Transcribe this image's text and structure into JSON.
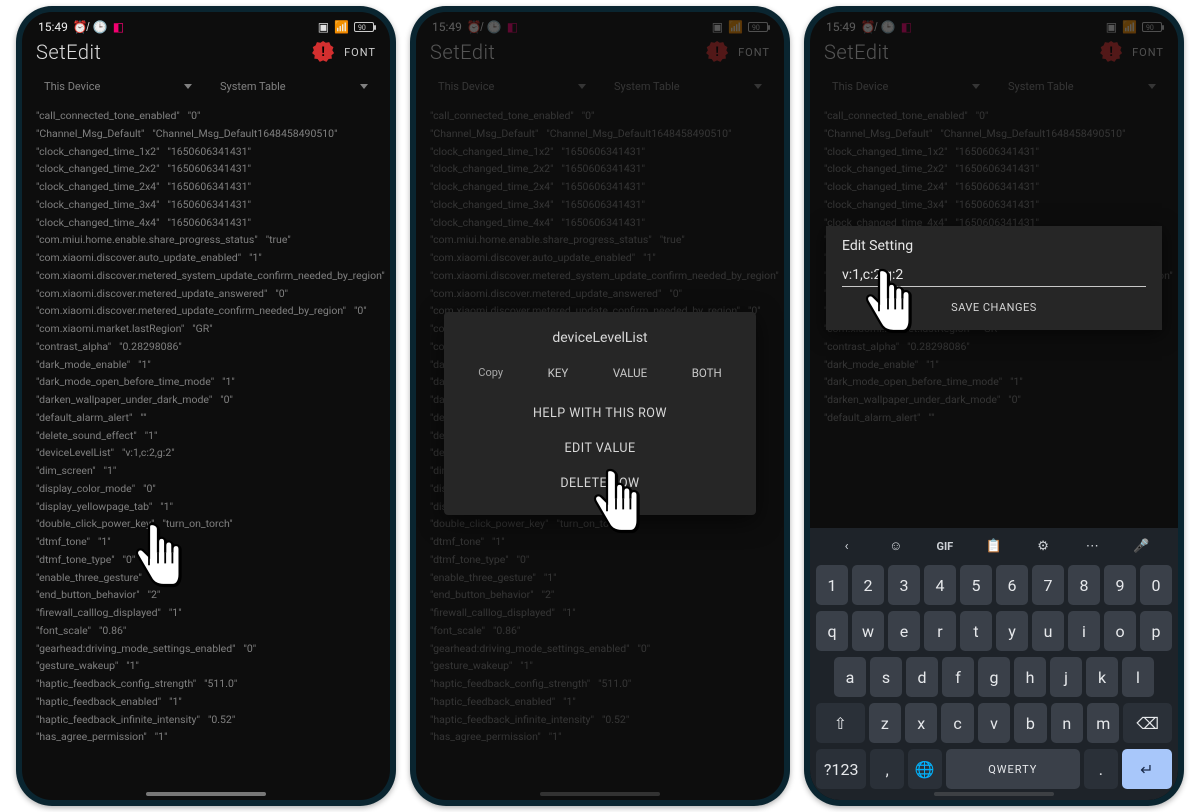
{
  "status": {
    "time": "15:49",
    "icons_left": [
      "alarm-off",
      "clock",
      "app-icon"
    ],
    "icons_right": [
      "vibrate",
      "wifi"
    ],
    "battery": "90"
  },
  "appbar": {
    "title": "SetEdit",
    "font_label": "FONT"
  },
  "dropdowns": {
    "device": "This Device",
    "table": "System Table"
  },
  "settings": [
    {
      "k": "call_connected_tone_enabled",
      "v": "0"
    },
    {
      "k": "Channel_Msg_Default",
      "v": "Channel_Msg_Default1648458490510"
    },
    {
      "k": "clock_changed_time_1x2",
      "v": "1650606341431"
    },
    {
      "k": "clock_changed_time_2x2",
      "v": "1650606341431"
    },
    {
      "k": "clock_changed_time_2x4",
      "v": "1650606341431"
    },
    {
      "k": "clock_changed_time_3x4",
      "v": "1650606341431"
    },
    {
      "k": "clock_changed_time_4x4",
      "v": "1650606341431"
    },
    {
      "k": "com.miui.home.enable.share_progress_status",
      "v": "true"
    },
    {
      "k": "com.xiaomi.discover.auto_update_enabled",
      "v": "1"
    },
    {
      "k": "com.xiaomi.discover.metered_system_update_confirm_needed_by_region",
      "v": "0"
    },
    {
      "k": "com.xiaomi.discover.metered_update_answered",
      "v": "0"
    },
    {
      "k": "com.xiaomi.discover.metered_update_confirm_needed_by_region",
      "v": "0"
    },
    {
      "k": "com.xiaomi.market.lastRegion",
      "v": "GR"
    },
    {
      "k": "contrast_alpha",
      "v": "0.28298086"
    },
    {
      "k": "dark_mode_enable",
      "v": "1"
    },
    {
      "k": "dark_mode_open_before_time_mode",
      "v": "1"
    },
    {
      "k": "darken_wallpaper_under_dark_mode",
      "v": "0"
    },
    {
      "k": "default_alarm_alert",
      "v": ""
    },
    {
      "k": "delete_sound_effect",
      "v": "1"
    },
    {
      "k": "deviceLevelList",
      "v": "v:1,c:2,g:2"
    },
    {
      "k": "dim_screen",
      "v": "1"
    },
    {
      "k": "display_color_mode",
      "v": "0"
    },
    {
      "k": "display_yellowpage_tab",
      "v": "1"
    },
    {
      "k": "double_click_power_key",
      "v": "turn_on_torch"
    },
    {
      "k": "dtmf_tone",
      "v": "1"
    },
    {
      "k": "dtmf_tone_type",
      "v": "0"
    },
    {
      "k": "enable_three_gesture",
      "v": "1"
    },
    {
      "k": "end_button_behavior",
      "v": "2"
    },
    {
      "k": "firewall_calllog_displayed",
      "v": "1"
    },
    {
      "k": "font_scale",
      "v": "0.86"
    },
    {
      "k": "gearhead:driving_mode_settings_enabled",
      "v": "0"
    },
    {
      "k": "gesture_wakeup",
      "v": "1"
    },
    {
      "k": "haptic_feedback_config_strength",
      "v": "511.0"
    },
    {
      "k": "haptic_feedback_enabled",
      "v": "1"
    },
    {
      "k": "haptic_feedback_infinite_intensity",
      "v": "0.52"
    },
    {
      "k": "has_agree_permission",
      "v": "1"
    }
  ],
  "context_menu": {
    "title": "deviceLevelList",
    "copy_label": "Copy",
    "key_label": "KEY",
    "value_label": "VALUE",
    "both_label": "BOTH",
    "help_label": "HELP WITH THIS ROW",
    "edit_label": "EDIT VALUE",
    "delete_label": "DELETE ROW"
  },
  "edit_dialog": {
    "title": "Edit Setting",
    "value": "v:1,c:2,g:2",
    "save_label": "SAVE CHANGES"
  },
  "keyboard": {
    "tools": [
      "‹",
      "☺",
      "GIF",
      "📋",
      "⚙",
      "⋯",
      "🎤"
    ],
    "row1": [
      "1",
      "2",
      "3",
      "4",
      "5",
      "6",
      "7",
      "8",
      "9",
      "0"
    ],
    "row2": [
      "q",
      "w",
      "e",
      "r",
      "t",
      "y",
      "u",
      "i",
      "o",
      "p"
    ],
    "row3": [
      "a",
      "s",
      "d",
      "f",
      "g",
      "h",
      "j",
      "k",
      "l"
    ],
    "row4_shift": "⇧",
    "row4": [
      "z",
      "x",
      "c",
      "v",
      "b",
      "n",
      "m"
    ],
    "row4_bksp": "⌫",
    "row5_sym": "?123",
    "row5_comma": ",",
    "row5_emoji": "☺",
    "row5_lang": "🌐",
    "row5_space": "QWERTY",
    "row5_dot": ".",
    "row5_enter": "↵"
  }
}
